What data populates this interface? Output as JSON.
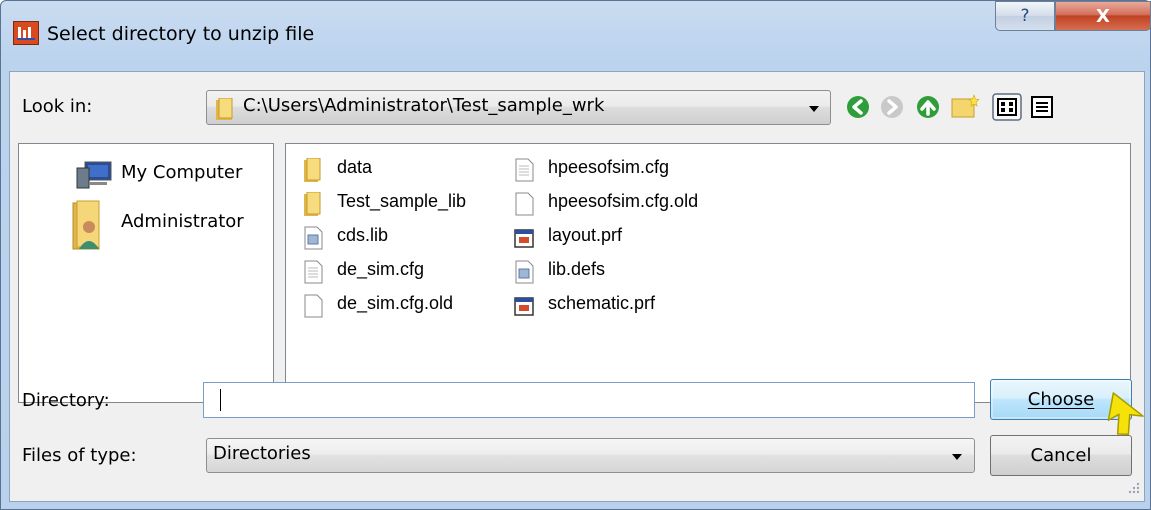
{
  "window": {
    "title": "Select directory to unzip file",
    "help_glyph": "?",
    "close_glyph": "X"
  },
  "look_in": {
    "label": "Look in:",
    "path": "C:\\Users\\Administrator\\Test_sample_wrk"
  },
  "toolbar": {
    "icons": [
      "back-icon",
      "forward-icon",
      "up-folder-icon",
      "new-folder-icon",
      "list-view-icon",
      "details-view-icon"
    ]
  },
  "places": [
    {
      "label": "My Computer",
      "icon": "computer-icon"
    },
    {
      "label": "Administrator",
      "icon": "user-folder-icon"
    }
  ],
  "files": [
    {
      "name": "data",
      "icon": "folder-icon"
    },
    {
      "name": "Test_sample_lib",
      "icon": "folder-icon"
    },
    {
      "name": "cds.lib",
      "icon": "text-file-icon"
    },
    {
      "name": "de_sim.cfg",
      "icon": "text-file-icon"
    },
    {
      "name": "de_sim.cfg.old",
      "icon": "blank-file-icon"
    },
    {
      "name": "hpeesofsim.cfg",
      "icon": "text-file-icon"
    },
    {
      "name": "hpeesofsim.cfg.old",
      "icon": "blank-file-icon"
    },
    {
      "name": "layout.prf",
      "icon": "app-file-icon"
    },
    {
      "name": "lib.defs",
      "icon": "text-file-icon"
    },
    {
      "name": "schematic.prf",
      "icon": "app-file-icon"
    }
  ],
  "directory": {
    "label": "Directory:",
    "value": ""
  },
  "file_type": {
    "label": "Files of type:",
    "selected": "Directories"
  },
  "buttons": {
    "choose": "Choose",
    "cancel": "Cancel"
  },
  "colors": {
    "title_gradient_top": "#c9dcf1",
    "close_red": "#c04225",
    "choose_highlight": "#bee6fd",
    "pointer_yellow": "#f5e20a"
  }
}
